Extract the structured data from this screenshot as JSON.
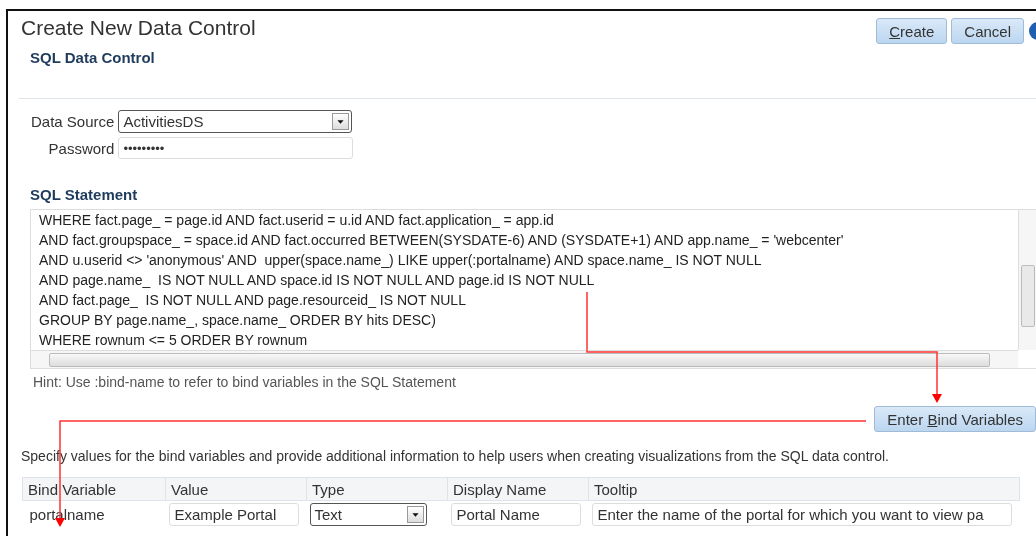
{
  "dialog": {
    "title": "Create New Data Control",
    "subtitle": "SQL Data Control",
    "buttons": [
      {
        "parts": [
          {
            "text": "C",
            "underlined": true
          },
          {
            "text": "reate",
            "underlined": false
          }
        ]
      },
      {
        "parts": [
          {
            "text": "Cancel",
            "underlined": false
          }
        ]
      }
    ]
  },
  "data_source": {
    "label": "Data Source",
    "value": "ActivitiesDS"
  },
  "password": {
    "label": "Password",
    "value": "•••••••••"
  },
  "sql": {
    "heading": "SQL Statement",
    "lines": [
      "WHERE fact.page_ = page.id AND fact.userid = u.id AND fact.application_ = app.id",
      "AND fact.groupspace_ = space.id AND fact.occurred BETWEEN(SYSDATE-6) AND (SYSDATE+1) AND app.name_ = 'webcenter'",
      "AND u.userid <> 'anonymous' AND  upper(space.name_) LIKE upper(:portalname) AND space.name_ IS NOT NULL",
      "AND page.name_  IS NOT NULL AND space.id IS NOT NULL AND page.id IS NOT NULL",
      "AND fact.page_  IS NOT NULL AND page.resourceid_ IS NOT NULL",
      "GROUP BY page.name_, space.name_ ORDER BY hits DESC)",
      "WHERE rownum <= 5 ORDER BY rownum"
    ],
    "hint": "Hint: Use :bind-name to refer to bind variables in the SQL Statement"
  },
  "bind_button": {
    "parts": [
      {
        "text": "Enter ",
        "underlined": false
      },
      {
        "text": "B",
        "underlined": true
      },
      {
        "text": "ind Variables",
        "underlined": false
      }
    ]
  },
  "instructions": "Specify values for the bind variables and provide additional information to help users when creating visualizations from the SQL data control.",
  "table": {
    "columns": [
      "Bind Variable",
      "Value",
      "Type",
      "Display Name",
      "Tooltip"
    ],
    "rows": [
      {
        "bind_variable": "portalname",
        "value": "Example Portal",
        "type": "Text",
        "display_name": "Portal Name",
        "tooltip": "Enter the name of the portal for which you want to view pa"
      }
    ]
  }
}
